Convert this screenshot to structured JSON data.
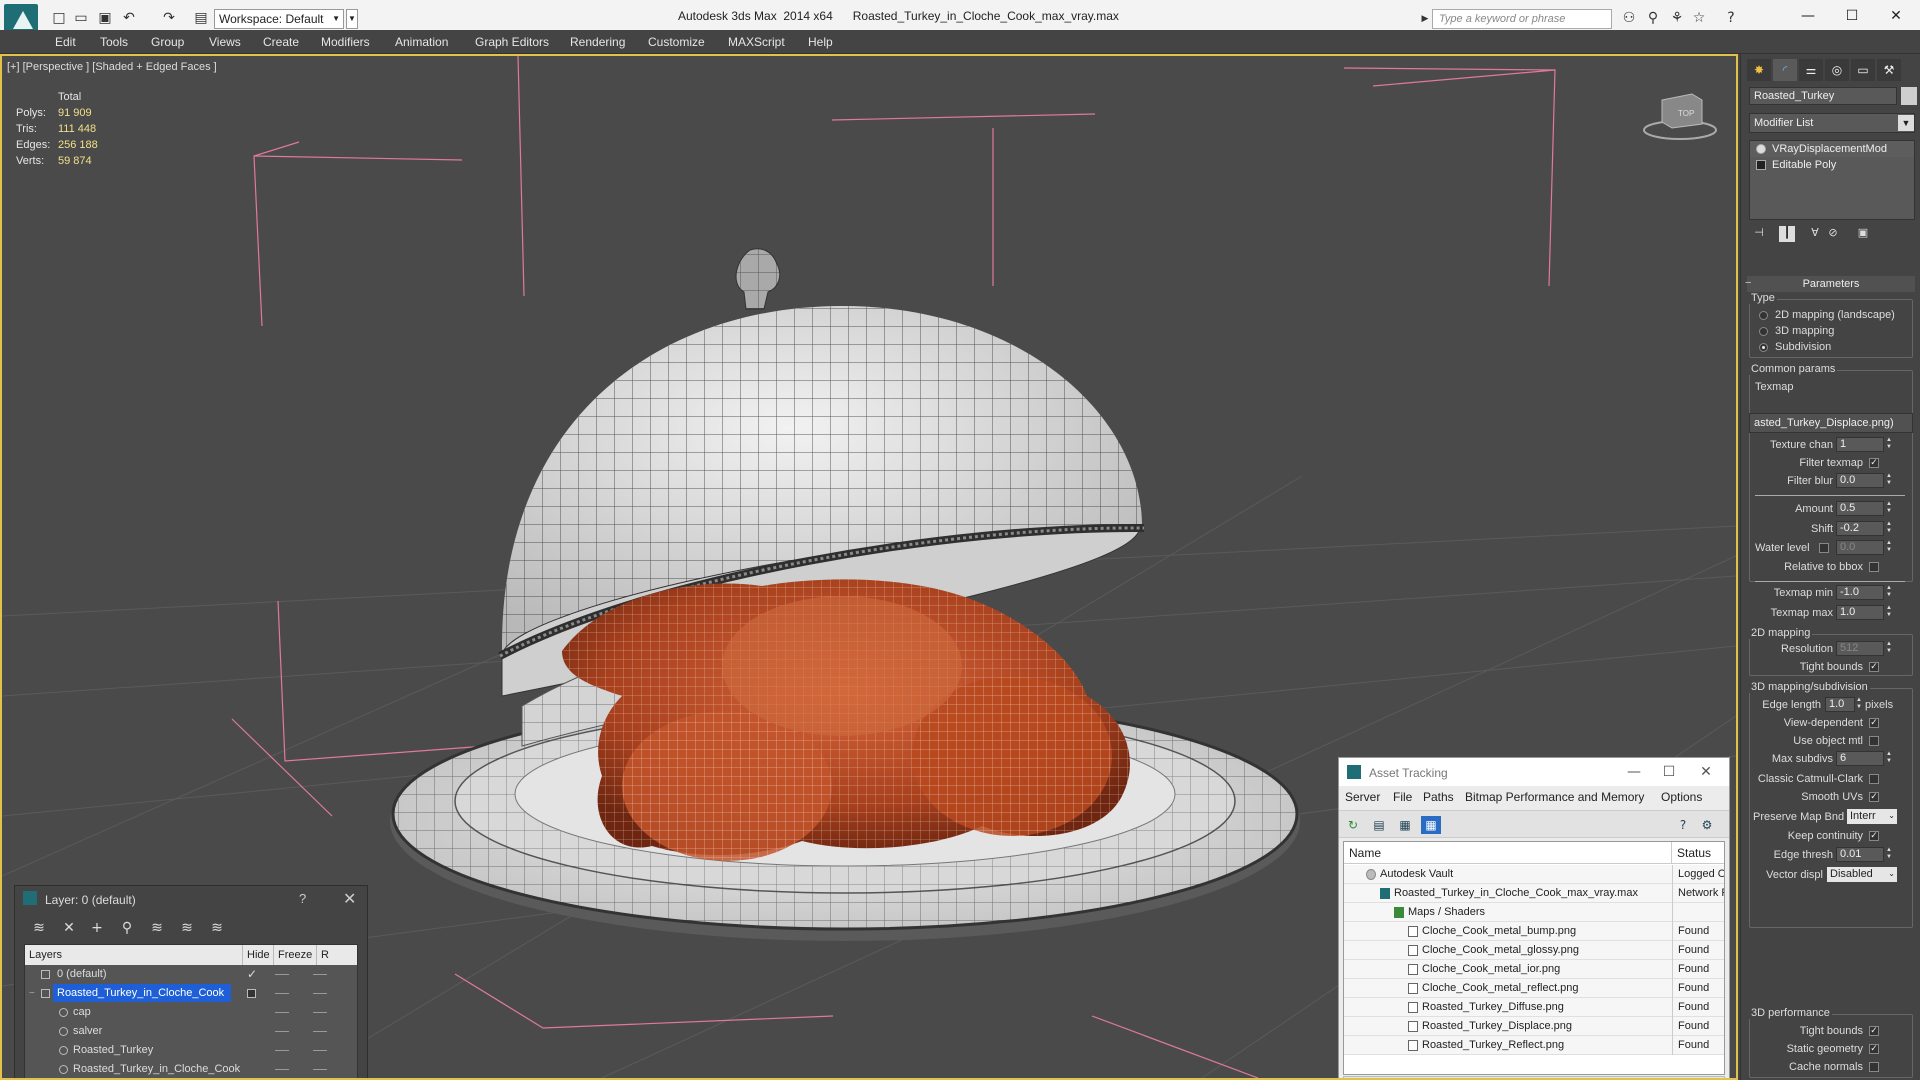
{
  "titlebar": {
    "workspace": "Workspace: Default",
    "app_title": "Autodesk 3ds Max  2014 x64      Roasted_Turkey_in_Cloche_Cook_max_vray.max",
    "search_placeholder": "Type a keyword or phrase"
  },
  "menu": [
    "Edit",
    "Tools",
    "Group",
    "Views",
    "Create",
    "Modifiers",
    "Animation",
    "Graph Editors",
    "Rendering",
    "Customize",
    "MAXScript",
    "Help"
  ],
  "viewport": {
    "label": "[+] [Perspective ] [Shaded + Edged Faces ]",
    "stats": {
      "header": "Total",
      "rows": [
        {
          "k": "Polys:",
          "v": "91 909"
        },
        {
          "k": "Tris:",
          "v": "111 448"
        },
        {
          "k": "Edges:",
          "v": "256 188"
        },
        {
          "k": "Verts:",
          "v": "59 874"
        }
      ]
    },
    "viewcube_label": "TOP"
  },
  "command_panel": {
    "object_name": "Roasted_Turkey",
    "modifier_list": "Modifier List",
    "stack": [
      "VRayDisplacementMod",
      "Editable Poly"
    ],
    "parameters_title": "Parameters",
    "type_label": "Type",
    "type_options": [
      "2D mapping (landscape)",
      "3D mapping",
      "Subdivision"
    ],
    "type_selected": 2,
    "common_label": "Common params",
    "texmap_label": "Texmap",
    "texmap_value": "asted_Turkey_Displace.png)",
    "texture_chan_label": "Texture chan",
    "texture_chan_value": "1",
    "filter_texmap_label": "Filter texmap",
    "filter_blur_label": "Filter blur",
    "filter_blur_value": "0.0",
    "amount_label": "Amount",
    "amount_value": "0.5",
    "shift_label": "Shift",
    "shift_value": "-0.2",
    "water_level_label": "Water level",
    "water_level_value": "0.0",
    "relative_bbox_label": "Relative to bbox",
    "texmap_min_label": "Texmap min",
    "texmap_min_value": "-1.0",
    "texmap_max_label": "Texmap max",
    "texmap_max_value": "1.0",
    "mapping2d_label": "2D mapping",
    "resolution_label": "Resolution",
    "resolution_value": "512",
    "tight_bounds_label": "Tight bounds",
    "mapping3d_label": "3D mapping/subdivision",
    "edge_length_label": "Edge length",
    "edge_length_value": "1.0",
    "pixels_label": "pixels",
    "view_dependent_label": "View-dependent",
    "use_object_mtl_label": "Use object mtl",
    "max_subdivs_label": "Max subdivs",
    "max_subdivs_value": "6",
    "catmull_label": "Classic Catmull-Clark",
    "smooth_uvs_label": "Smooth UVs",
    "preserve_label": "Preserve Map Bnd",
    "preserve_value": "Interr",
    "keep_continuity_label": "Keep continuity",
    "edge_thresh_label": "Edge thresh",
    "edge_thresh_value": "0.01",
    "vector_displ_label": "Vector displ",
    "vector_displ_value": "Disabled",
    "perf_label": "3D performance",
    "perf_tight_label": "Tight bounds",
    "static_geom_label": "Static geometry",
    "cache_normals_label": "Cache normals"
  },
  "layer_window": {
    "title": "Layer: 0 (default)",
    "help": "?",
    "columns": [
      "Layers",
      "Hide",
      "Freeze",
      "R"
    ],
    "rows": [
      {
        "name": "0 (default)",
        "indent": 0
      },
      {
        "name": "Roasted_Turkey_in_Cloche_Cook",
        "indent": 0
      },
      {
        "name": "cap",
        "indent": 1
      },
      {
        "name": "salver",
        "indent": 1
      },
      {
        "name": "Roasted_Turkey",
        "indent": 1
      },
      {
        "name": "Roasted_Turkey_in_Cloche_Cook",
        "indent": 1
      }
    ]
  },
  "asset_window": {
    "title": "Asset Tracking",
    "menu": [
      "Server",
      "File",
      "Paths",
      "Bitmap Performance and Memory",
      "Options"
    ],
    "columns": [
      "Name",
      "Status"
    ],
    "rows": [
      {
        "name": "Autodesk Vault",
        "status": "Logged O",
        "indent": 1,
        "icon": "vault"
      },
      {
        "name": "Roasted_Turkey_in_Cloche_Cook_max_vray.max",
        "status": "Network P",
        "indent": 2,
        "icon": "max"
      },
      {
        "name": "Maps / Shaders",
        "status": "",
        "indent": 3,
        "icon": "green"
      },
      {
        "name": "Cloche_Cook_metal_bump.png",
        "status": "Found",
        "indent": 4,
        "icon": "file"
      },
      {
        "name": "Cloche_Cook_metal_glossy.png",
        "status": "Found",
        "indent": 4,
        "icon": "file"
      },
      {
        "name": "Cloche_Cook_metal_ior.png",
        "status": "Found",
        "indent": 4,
        "icon": "file"
      },
      {
        "name": "Cloche_Cook_metal_reflect.png",
        "status": "Found",
        "indent": 4,
        "icon": "file"
      },
      {
        "name": "Roasted_Turkey_Diffuse.png",
        "status": "Found",
        "indent": 4,
        "icon": "file"
      },
      {
        "name": "Roasted_Turkey_Displace.png",
        "status": "Found",
        "indent": 4,
        "icon": "file"
      },
      {
        "name": "Roasted_Turkey_Reflect.png",
        "status": "Found",
        "indent": 4,
        "icon": "file"
      }
    ]
  },
  "colors": {
    "viewport_border": "#e1c24a",
    "selection_blue": "#1e5fd8",
    "stats_value": "#f0e08a",
    "bbox_pink": "#e07a9a",
    "turkey": "#b24a22"
  }
}
